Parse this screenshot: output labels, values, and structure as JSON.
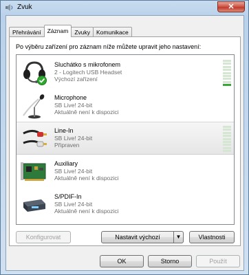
{
  "window": {
    "title": "Zvuk",
    "close_label": "✕"
  },
  "tabs": [
    {
      "label": "Přehrávání",
      "active": false
    },
    {
      "label": "Záznam",
      "active": true
    },
    {
      "label": "Zvuky",
      "active": false
    },
    {
      "label": "Komunikace",
      "active": false
    }
  ],
  "instruction": "Po výběru zařízení pro záznam níže můžete upravit jeho nastavení:",
  "devices": [
    {
      "name": "Sluchátko s mikrofonem",
      "line2": "2 - Logitech USB Headset",
      "line3": "Výchozí zařízení",
      "icon": "headset-icon",
      "meter_level": 0.15,
      "selected": false
    },
    {
      "name": "Microphone",
      "line2": "SB Live! 24-bit",
      "line3": "Aktuálně není k dispozici",
      "icon": "microphone-icon",
      "meter_level": 0,
      "selected": false
    },
    {
      "name": "Line-In",
      "line2": "SB Live! 24-bit",
      "line3": "Připraven",
      "icon": "line-in-cable-icon",
      "meter_level": 0,
      "selected": true
    },
    {
      "name": "Auxiliary",
      "line2": "SB Live! 24-bit",
      "line3": "Aktuálně není k dispozici",
      "icon": "sound-card-icon",
      "meter_level": 0,
      "selected": false
    },
    {
      "name": "S/PDIF-In",
      "line2": "SB Live! 24-bit",
      "line3": "Aktuálně není k dispozici",
      "icon": "spdif-device-icon",
      "meter_level": 0,
      "selected": false
    }
  ],
  "buttons": {
    "configure": "Konfigurovat",
    "set_default": "Nastavit výchozí",
    "set_default_arrow": "▼",
    "properties": "Vlastnosti",
    "ok": "OK",
    "cancel": "Storno",
    "apply": "Použít"
  },
  "colors": {
    "meter_on": "#3aa63a",
    "meter_off": "#d5e6d2",
    "check_green": "#2ea82e"
  }
}
